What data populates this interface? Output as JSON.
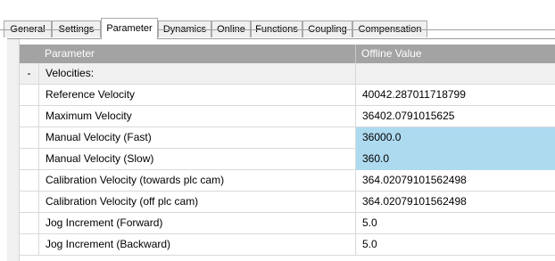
{
  "tabs": [
    {
      "label": "General"
    },
    {
      "label": "Settings"
    },
    {
      "label": "Parameter",
      "active": true
    },
    {
      "label": "Dynamics"
    },
    {
      "label": "Online"
    },
    {
      "label": "Functions"
    },
    {
      "label": "Coupling"
    },
    {
      "label": "Compensation"
    }
  ],
  "grid": {
    "columns": {
      "parameter": "Parameter",
      "offline_value": "Offline Value"
    },
    "group": {
      "marker": "-",
      "label": "Velocities:"
    },
    "rows": [
      {
        "name": "Reference Velocity",
        "value": "40042.287011718799",
        "highlight": false
      },
      {
        "name": "Maximum Velocity",
        "value": "36402.0791015625",
        "highlight": false
      },
      {
        "name": "Manual Velocity (Fast)",
        "value": "36000.0",
        "highlight": true
      },
      {
        "name": "Manual Velocity (Slow)",
        "value": "360.0",
        "highlight": true
      },
      {
        "name": "Calibration Velocity (towards plc cam)",
        "value": "364.02079101562498",
        "highlight": false
      },
      {
        "name": "Calibration Velocity (off plc cam)",
        "value": "364.02079101562498",
        "highlight": false
      },
      {
        "name": "Jog Increment (Forward)",
        "value": "5.0",
        "highlight": false
      },
      {
        "name": "Jog Increment (Backward)",
        "value": "5.0",
        "highlight": false
      }
    ]
  },
  "colors": {
    "header_bg": "#a3a3a3",
    "highlight_bg": "#aedaf0",
    "group_bg": "#f0f0f0"
  }
}
